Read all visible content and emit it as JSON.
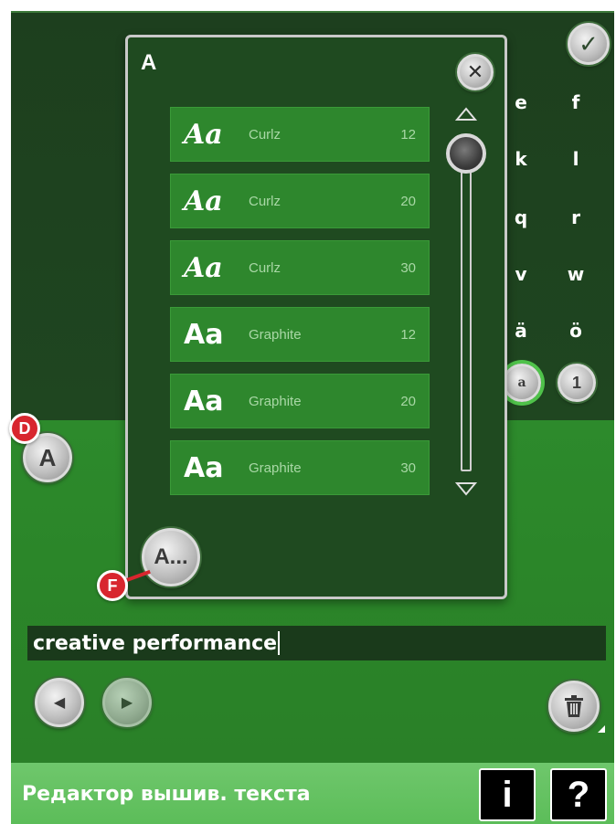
{
  "title": "A",
  "keyboard": {
    "keys": [
      "e",
      "f",
      "k",
      "l",
      "q",
      "r",
      "v",
      "w",
      "ä",
      "ö"
    ],
    "mode_lower": "a",
    "mode_number": "1"
  },
  "fonts": [
    {
      "preview": "Aa",
      "name": "Curlz",
      "size": "12"
    },
    {
      "preview": "Aa",
      "name": "Curlz",
      "size": "20"
    },
    {
      "preview": "Aa",
      "name": "Curlz",
      "size": "30"
    },
    {
      "preview": "Aa",
      "name": "Graphite",
      "size": "12"
    },
    {
      "preview": "Aa",
      "name": "Graphite",
      "size": "20"
    },
    {
      "preview": "Aa",
      "name": "Graphite",
      "size": "30"
    }
  ],
  "buttons": {
    "font_button": "A",
    "font_more": "A...",
    "close": "✕",
    "confirm": "✓",
    "prev": "◀",
    "next": "▶",
    "info": "i",
    "help": "?"
  },
  "markers": {
    "d": "D",
    "f": "F"
  },
  "text_input": {
    "value": "creative performance"
  },
  "status": {
    "title": "Редактор вышив. текста"
  },
  "icons": {
    "trash": "trash-icon",
    "scroll_up": "triangle-up-icon",
    "scroll_down": "triangle-down-icon"
  },
  "colors": {
    "accent_green": "#2e872d",
    "dark_green": "#1f4a20",
    "marker_red": "#d8262e"
  }
}
